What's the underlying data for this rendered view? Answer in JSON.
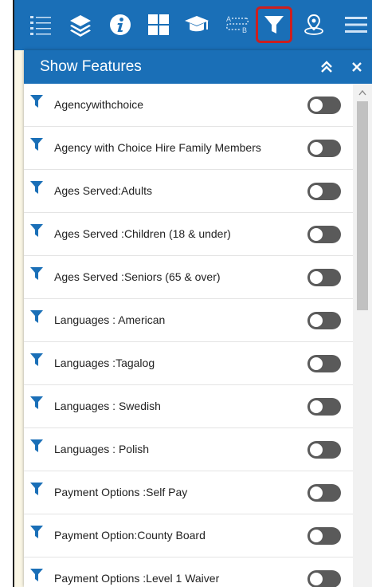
{
  "toolbar": {
    "tools": [
      {
        "name": "legend-icon",
        "active": false
      },
      {
        "name": "layers-icon",
        "active": false
      },
      {
        "name": "info-icon",
        "active": false
      },
      {
        "name": "basemap-grid-icon",
        "active": false
      },
      {
        "name": "education-cap-icon",
        "active": false
      },
      {
        "name": "directions-icon",
        "active": false,
        "text_a": "A",
        "text_b": "B"
      },
      {
        "name": "filter-icon",
        "active": true
      },
      {
        "name": "location-pin-icon",
        "active": false
      },
      {
        "name": "menu-icon",
        "active": false
      }
    ]
  },
  "panel": {
    "title": "Show Features",
    "collapse_symbol": "»",
    "close_symbol": "✕",
    "items": [
      {
        "label": "Agencywithchoice",
        "on": false
      },
      {
        "label": "Agency with Choice Hire Family Members",
        "on": false
      },
      {
        "label": "Ages Served:Adults",
        "on": false
      },
      {
        "label": "Ages Served :Children (18 & under)",
        "on": false
      },
      {
        "label": "Ages Served :Seniors (65 & over)",
        "on": false
      },
      {
        "label": "Languages : American",
        "on": false
      },
      {
        "label": "Languages :Tagalog",
        "on": false
      },
      {
        "label": "Languages : Swedish",
        "on": false
      },
      {
        "label": "Languages : Polish",
        "on": false
      },
      {
        "label": "Payment Options :Self Pay",
        "on": false
      },
      {
        "label": "Payment Option:County Board",
        "on": false
      },
      {
        "label": "Payment Options :Level 1 Waiver",
        "on": false
      }
    ]
  },
  "colors": {
    "toolbar_bg": "#1a6fb7",
    "active_border": "#cc1f1f",
    "filter_icon": "#1a6fb7",
    "toggle_off": "#5a5a5a"
  }
}
